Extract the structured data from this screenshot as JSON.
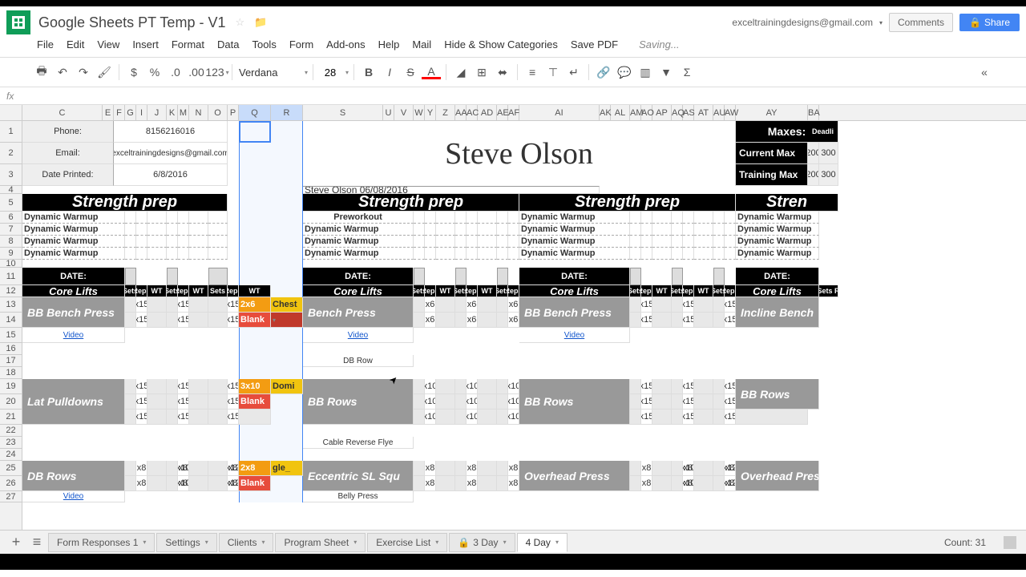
{
  "doc": {
    "title": "Google Sheets PT Temp - V1",
    "account": "exceltrainingdesigns@gmail.com",
    "saving": "Saving..."
  },
  "menu": [
    "File",
    "Edit",
    "View",
    "Insert",
    "Format",
    "Data",
    "Tools",
    "Form",
    "Add-ons",
    "Help",
    "Mail",
    "Hide & Show Categories",
    "Save PDF"
  ],
  "buttons": {
    "comments": "Comments",
    "share": "Share"
  },
  "toolbar": {
    "font": "Verdana",
    "size": "28"
  },
  "cols": [
    "C",
    "E",
    "F",
    "G",
    "I",
    "J",
    "K",
    "M",
    "N",
    "O",
    "P",
    "Q",
    "R",
    "S",
    "U",
    "V",
    "W",
    "Y",
    "Z",
    "AA",
    "AC",
    "AD",
    "AE",
    "AF",
    "AI",
    "AK",
    "AL",
    "AM",
    "AO",
    "AP",
    "AQ",
    "AS",
    "AT",
    "AU",
    "AW",
    "AY",
    "BA"
  ],
  "rows": [
    "1",
    "2",
    "3",
    "4",
    "5",
    "6",
    "7",
    "8",
    "9",
    "10",
    "11",
    "12",
    "13",
    "14",
    "15",
    "16",
    "17",
    "18",
    "19",
    "20",
    "21",
    "22",
    "23",
    "24",
    "25",
    "26",
    "27"
  ],
  "info": {
    "phone_lbl": "Phone:",
    "phone": "8156216016",
    "email_lbl": "Email:",
    "email": "exceltrainingdesigns@gmail.com",
    "date_lbl": "Date Printed:",
    "date": "6/8/2016"
  },
  "title": "Steve Olson",
  "title_date": "Steve Olson 06/08/2016",
  "maxes": {
    "hdr": "Maxes:",
    "row1": "Current Max",
    "row1v": "200",
    "row1v2": "300",
    "row2": "Training Max",
    "row2v": "200",
    "row2v2": "300"
  },
  "strength": "Strength prep",
  "strength4": "Stren",
  "dyn": "Dynamic Warmup",
  "pre": "Preworkout",
  "date_hdr": "DATE:",
  "core": "Core Lifts",
  "srwt": {
    "s": "Sets",
    "r": "Reps",
    "w": "WT",
    "sr": "Sets R"
  },
  "ex": {
    "bb_bench": "BB Bench Press",
    "bench": "Bench Press",
    "incline": "Incline Bench",
    "lat": "Lat Pulldowns",
    "bb_rows": "BB Rows",
    "db_rows": "DB Rows",
    "ecc": "Eccentric SL Squ",
    "ohp": "Overhead Press",
    "ohp2": "Overhead Press"
  },
  "notes": {
    "dbrow": "DB Row",
    "cable": "Cable Reverse Flye",
    "belly": "Belly Press"
  },
  "video": "Video",
  "reps": {
    "x15": "x15",
    "x6": "x6",
    "x10": "x10",
    "x8": "x8",
    "x12": "x12"
  },
  "tags": {
    "t26": "2x6",
    "t310": "3x10",
    "t28": "2x8",
    "chest": "Chest",
    "domi": "Domi",
    "gle": "gle_",
    "blank": "Blank"
  },
  "tabs": [
    "Form Responses 1",
    "Settings",
    "Clients",
    "Program Sheet",
    "Exercise List",
    "3 Day",
    "4 Day"
  ],
  "count": "Count: 31"
}
